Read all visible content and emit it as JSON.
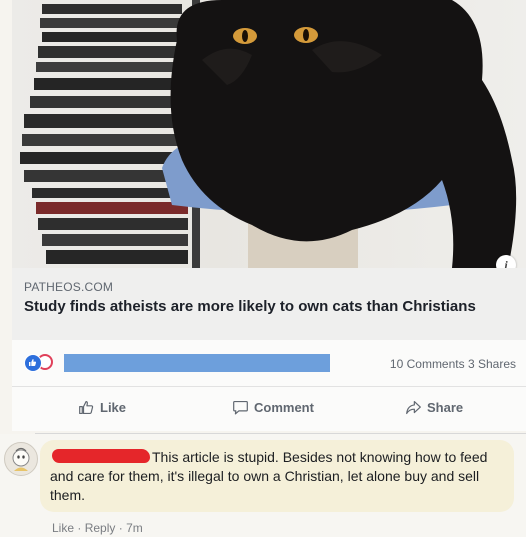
{
  "post": {
    "image_alt": "black long-haired cat sitting on a blue scratching post beside a stack of CD cases",
    "link": {
      "domain": "PATHEOS.COM",
      "title": "Study finds atheists are more likely to own cats than Christians"
    },
    "stats": {
      "comments": "10 Comments",
      "shares": "3 Shares"
    },
    "actions": {
      "like": "Like",
      "comment": "Comment",
      "share": "Share"
    },
    "icons": {
      "info": "info-icon",
      "like": "thumbs-up-icon",
      "comment": "speech-bubble-icon",
      "share": "share-arrow-icon"
    }
  },
  "comment": {
    "text": "This article is stupid. Besides not knowing how to feed and care for them, it's illegal to own a Christian, let alone buy and sell them.",
    "meta": {
      "like": "Like",
      "separator": "·",
      "reply": "Reply",
      "time": "7m"
    }
  },
  "colors": {
    "like_reaction": "#2d6fdc",
    "love_reaction": "#e0405a",
    "redaction_blue": "#6d9fdc",
    "redaction_red": "#e5262a",
    "comment_bubble": "#f5f0d9"
  }
}
